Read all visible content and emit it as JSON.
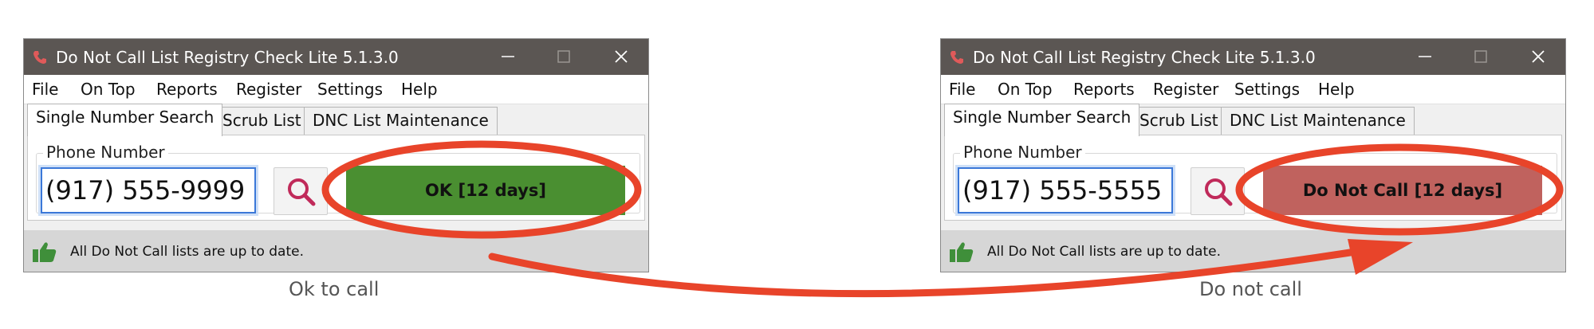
{
  "colors": {
    "titlebar": "#5b5653",
    "ok_green": "#4a8f31",
    "dnc_red": "#c0625e",
    "annotation_red": "#e8442a",
    "statusbar": "#d6d6d6",
    "search_icon": "#c02a5a"
  },
  "windows": [
    {
      "id": "left",
      "title": "Do Not Call List Registry Check Lite 5.1.3.0",
      "menu": [
        "File",
        "On Top",
        "Reports",
        "Register",
        "Settings",
        "Help"
      ],
      "tabs": [
        "Single Number Search",
        "Scrub List",
        "DNC List Maintenance"
      ],
      "group_label": "Phone Number",
      "phone_value": "(917) 555-9999",
      "search_icon": "magnifier-icon",
      "result_text": "OK [12 days]",
      "result_status": "ok",
      "status_icon": "thumbs-up-icon",
      "status_text": "All Do Not Call lists are up to date.",
      "caption": "Ok to call"
    },
    {
      "id": "right",
      "title": "Do Not Call List Registry Check Lite 5.1.3.0",
      "menu": [
        "File",
        "On Top",
        "Reports",
        "Register",
        "Settings",
        "Help"
      ],
      "tabs": [
        "Single Number Search",
        "Scrub List",
        "DNC List Maintenance"
      ],
      "group_label": "Phone Number",
      "phone_value": "(917) 555-5555",
      "search_icon": "magnifier-icon",
      "result_text": "Do Not Call [12 days]",
      "result_status": "do-not-call",
      "status_icon": "thumbs-up-icon",
      "status_text": "All Do Not Call lists are up to date.",
      "caption": "Do not call"
    }
  ]
}
